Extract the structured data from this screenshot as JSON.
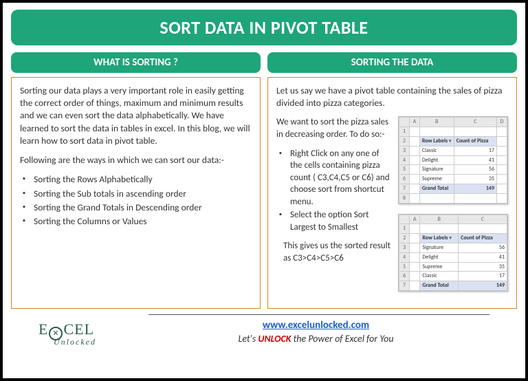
{
  "title": "SORT DATA IN PIVOT TABLE",
  "left": {
    "header": "WHAT IS SORTING ?",
    "para1": "Sorting our data plays a very important role in easily getting the correct order of things, maximum and minimum results and we can even sort the data alphabetically. We have learned to sort the data in tables in excel. In this blog, we will learn how to sort data in pivot table.",
    "para2": "Following are the ways in which we can sort our data:-",
    "b1": "Sorting the Rows Alphabetically",
    "b2": "Sorting the Sub totals in ascending order",
    "b3": "Sorting the Grand Totals in Descending order",
    "b4": "Sorting the Columns or Values"
  },
  "right": {
    "header": "SORTING THE DATA",
    "intro": "Let us say we have a pivot table containing the sales of pizza divided into pizza categories.",
    "p1": "We want to sort the pizza sales in decreasing order. To do so:-",
    "s1": "Right Click on any one of the cells containing pizza count ( C3,C4,C5 or C6) and choose sort from shortcut menu.",
    "s2": "Select the option Sort Largest to Smallest",
    "result": "This gives us the sorted result as C3>C4>C5>C6"
  },
  "table1": {
    "h1": "Row Labels",
    "h2": "Count of Pizza",
    "r1a": "Classic",
    "r1b": "17",
    "r2a": "Delight",
    "r2b": "41",
    "r3a": "Signature",
    "r3b": "56",
    "r4a": "Supreme",
    "r4b": "35",
    "gt": "Grand Total",
    "gtv": "149"
  },
  "table2": {
    "h1": "Row Labels",
    "h2": "Count of Pizza",
    "r1a": "Signature",
    "r1b": "56",
    "r2a": "Delight",
    "r2b": "41",
    "r3a": "Supreme",
    "r3b": "35",
    "r4a": "Classic",
    "r4b": "17",
    "gt": "Grand Total",
    "gtv": "149"
  },
  "footer": {
    "url": "www.excelunlocked.com",
    "tag_pre": "Let's ",
    "tag_unlock": "UNLOCK",
    "tag_post": " the Power of Excel for You",
    "logo_a": "E",
    "logo_b": "CEL",
    "logo_sub": "Unlocked"
  }
}
